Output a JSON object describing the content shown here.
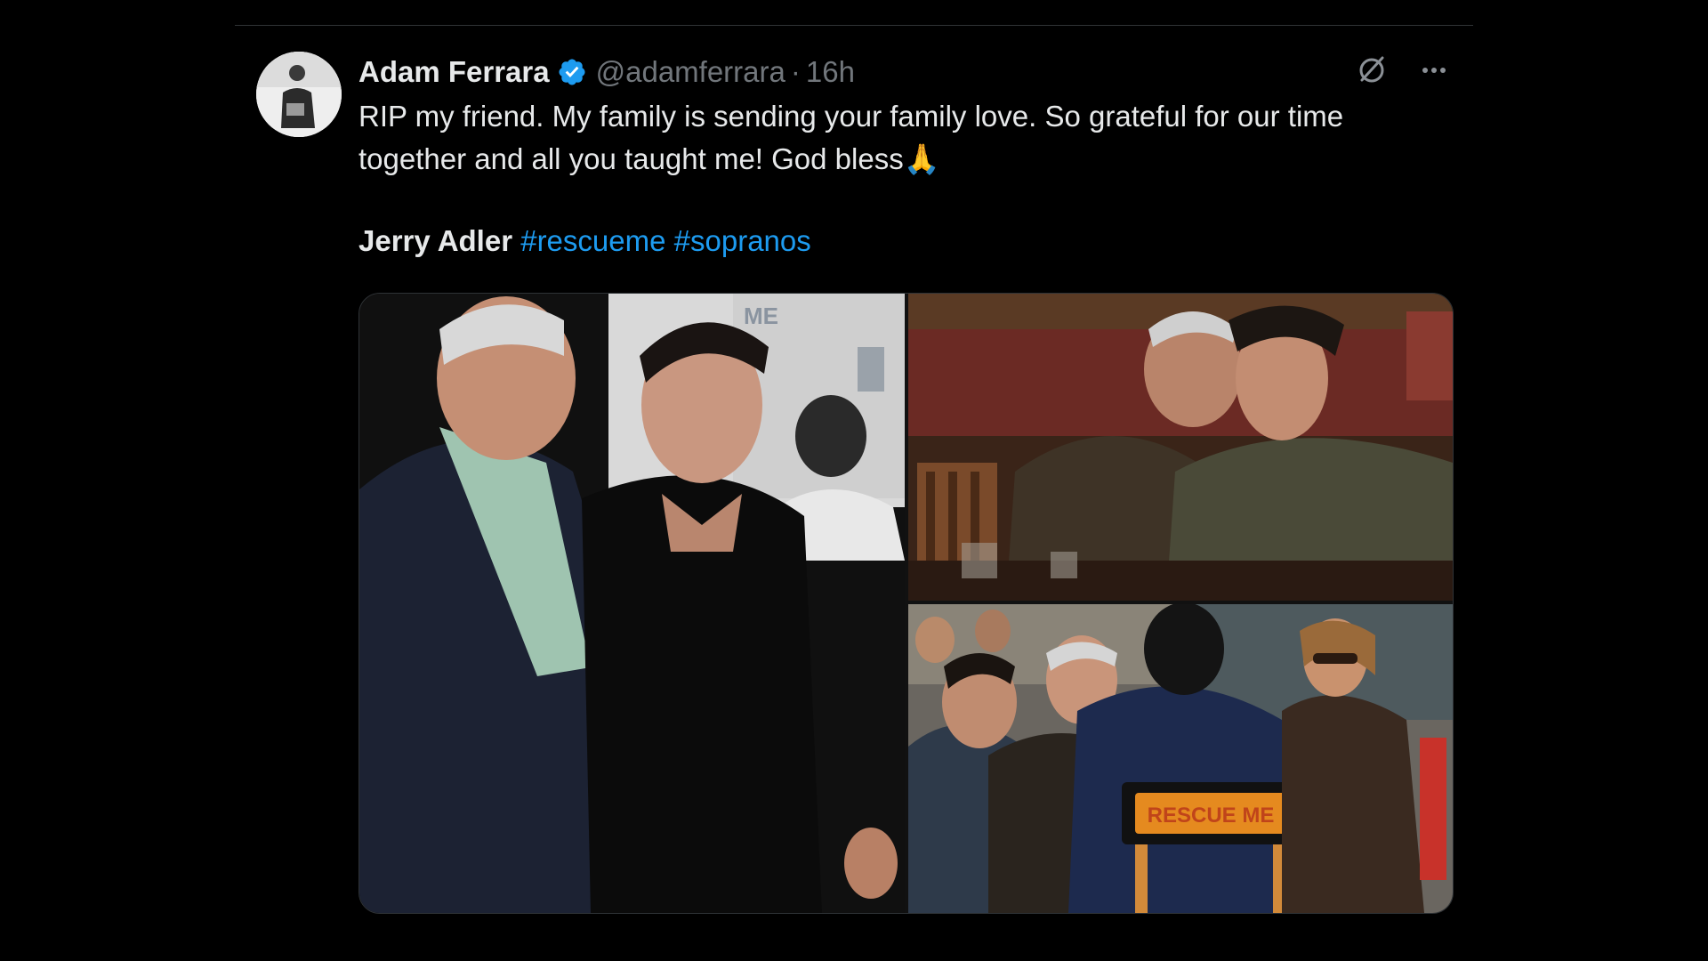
{
  "tweet": {
    "author": {
      "display_name": "Adam Ferrara",
      "handle": "@adamferrara",
      "verified": true,
      "verified_color": "#1d9bf0"
    },
    "separator": "·",
    "time": "16h",
    "text": "RIP my friend. My family is sending your family love. So grateful for our time together and all you taught me! God bless🙏",
    "tag_line": {
      "name": "Jerry Adler",
      "hashtags": [
        "#rescueme",
        "#sopranos"
      ]
    },
    "actions": {
      "grok_icon": "grok-icon",
      "more_icon": "more-icon"
    },
    "media": {
      "chair_text": "RESCUE ME",
      "backdrop_text": "ME"
    }
  },
  "colors": {
    "background": "#000000",
    "text": "#e7e9ea",
    "muted": "#71767b",
    "link": "#1d9bf0",
    "divider": "#2f3336"
  }
}
